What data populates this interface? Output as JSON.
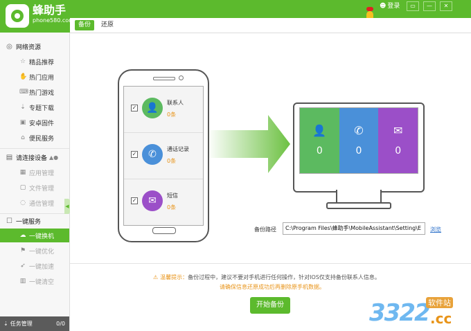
{
  "app": {
    "name": "蜂助手",
    "site": "phone580.com"
  },
  "titlebar": {
    "login_label": "登录",
    "menu_btn": "▭",
    "min_btn": "—",
    "close_btn": "✕"
  },
  "sidebar": {
    "sections": [
      {
        "label": "网络资源",
        "icon": "globe-icon",
        "glyph": "◎"
      },
      {
        "label": "请连接设备",
        "icon": "device-icon",
        "glyph": "▤"
      },
      {
        "label": "一键服务",
        "icon": "service-icon",
        "glyph": "☐"
      }
    ],
    "network_items": [
      {
        "label": "精品推荐",
        "icon": "star-icon",
        "glyph": "☆"
      },
      {
        "label": "热门应用",
        "icon": "hand-icon",
        "glyph": "✋"
      },
      {
        "label": "热门游戏",
        "icon": "gamepad-icon",
        "glyph": "⌨"
      },
      {
        "label": "专题下载",
        "icon": "download-icon",
        "glyph": "⇣"
      },
      {
        "label": "安卓固件",
        "icon": "firmware-icon",
        "glyph": "▣"
      },
      {
        "label": "便民服务",
        "icon": "service-home-icon",
        "glyph": "⌂"
      }
    ],
    "device_items": [
      {
        "label": "应用管理",
        "icon": "apps-icon",
        "glyph": "▦"
      },
      {
        "label": "文件管理",
        "icon": "folder-icon",
        "glyph": "▢"
      },
      {
        "label": "通信管理",
        "icon": "chat-icon",
        "glyph": "◌"
      }
    ],
    "service_items": [
      {
        "label": "一键换机",
        "icon": "cloud-icon",
        "glyph": "☁"
      },
      {
        "label": "一键优化",
        "icon": "optimize-icon",
        "glyph": "⚑"
      },
      {
        "label": "一键加速",
        "icon": "rocket-icon",
        "glyph": "➶"
      },
      {
        "label": "一键清空",
        "icon": "trash-icon",
        "glyph": "▥"
      }
    ],
    "taskbar": {
      "label": "任务管理",
      "count": "0/0"
    }
  },
  "tabs": {
    "backup": "备份",
    "restore": "还原"
  },
  "phone_rows": [
    {
      "label": "联系人",
      "count": "0条",
      "color": "#5cba60",
      "icon": "contact-icon",
      "glyph": "👤"
    },
    {
      "label": "通话记录",
      "count": "0条",
      "color": "#4a90d9",
      "icon": "phone-icon",
      "glyph": "✆"
    },
    {
      "label": "短信",
      "count": "0条",
      "color": "#9b4fc8",
      "icon": "sms-icon",
      "glyph": "✉"
    }
  ],
  "monitor_cols": [
    {
      "value": "0",
      "color": "#5cba60",
      "icon": "contact-icon",
      "glyph": "👤"
    },
    {
      "value": "0",
      "color": "#4a90d9",
      "icon": "phone-icon",
      "glyph": "✆"
    },
    {
      "value": "0",
      "color": "#9b4fc8",
      "icon": "sms-icon",
      "glyph": "✉"
    }
  ],
  "backup_path": {
    "label": "备份路径",
    "value": "C:\\Program Files\\蜂助手\\MobileAssistant\\Setting\\E",
    "browse": "浏览"
  },
  "tip": {
    "title": "温馨提示：",
    "text": "备份过程中，建议不要对手机进行任何操作，针对IOS仅支持备份联系人信息。",
    "line2": "请确保信息还原成功后再删除原手机数据。"
  },
  "start_button": "开始备份",
  "watermark": {
    "digits": "3322",
    "tag": "软件站",
    "tld": ".cc"
  },
  "colors": {
    "brand": "#5cba2d",
    "warn": "#e8941a"
  }
}
